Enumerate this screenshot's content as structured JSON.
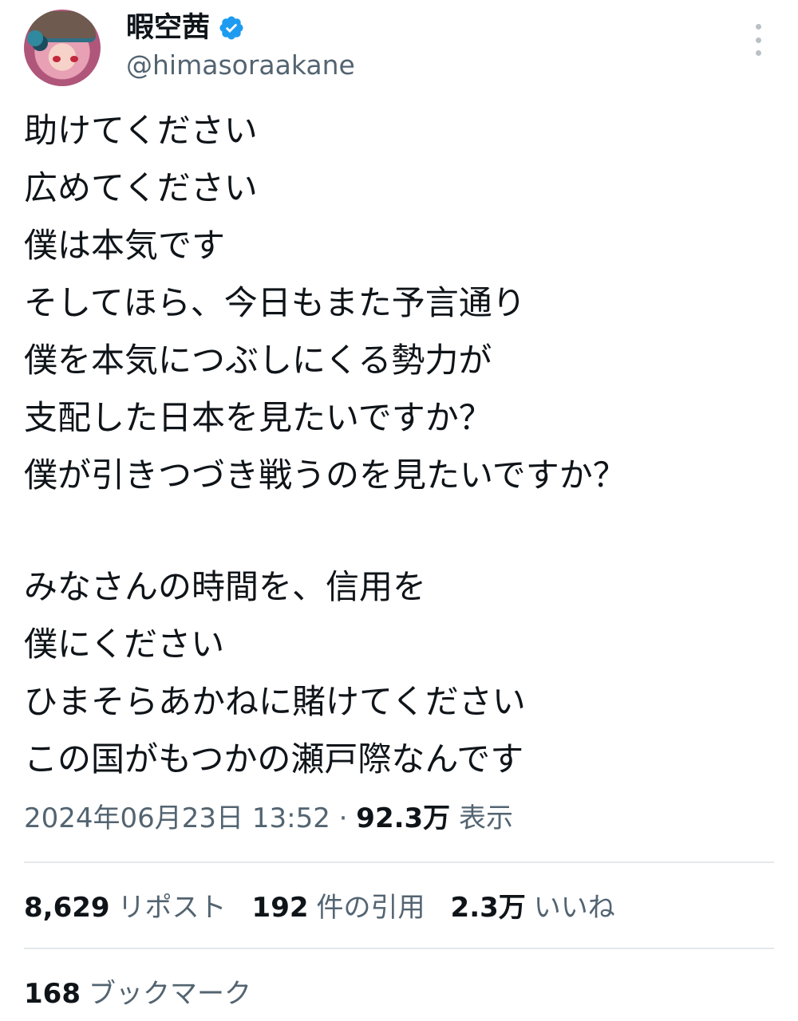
{
  "user": {
    "display_name": "暇空茜",
    "handle": "@himasoraakane",
    "verified_color": "#1d9bf0"
  },
  "tweet": {
    "lines": [
      "助けてください",
      "広めてください",
      "僕は本気です",
      "そしてほら、今日もまた予言通り",
      "僕を本気につぶしにくる勢力が",
      "支配した日本を見たいですか？",
      "僕が引きつづき戦うのを見たいですか？",
      "",
      "みなさんの時間を、信用を",
      "僕にください",
      "ひまそらあかねに賭けてください",
      "この国がもつかの瀬戸際なんです"
    ]
  },
  "meta": {
    "timestamp": "2024年06月23日 13:52",
    "separator": "·",
    "views_count": "92.3万",
    "views_label": "表示"
  },
  "stats": {
    "reposts_count": "8,629",
    "reposts_label": "リポスト",
    "quotes_count": "192",
    "quotes_label": "件の引用",
    "likes_count": "2.3万",
    "likes_label": "いいね",
    "bookmarks_count": "168",
    "bookmarks_label": "ブックマーク"
  },
  "icons": {
    "more": "more-vertical-icon",
    "verified": "verified-badge-icon"
  }
}
